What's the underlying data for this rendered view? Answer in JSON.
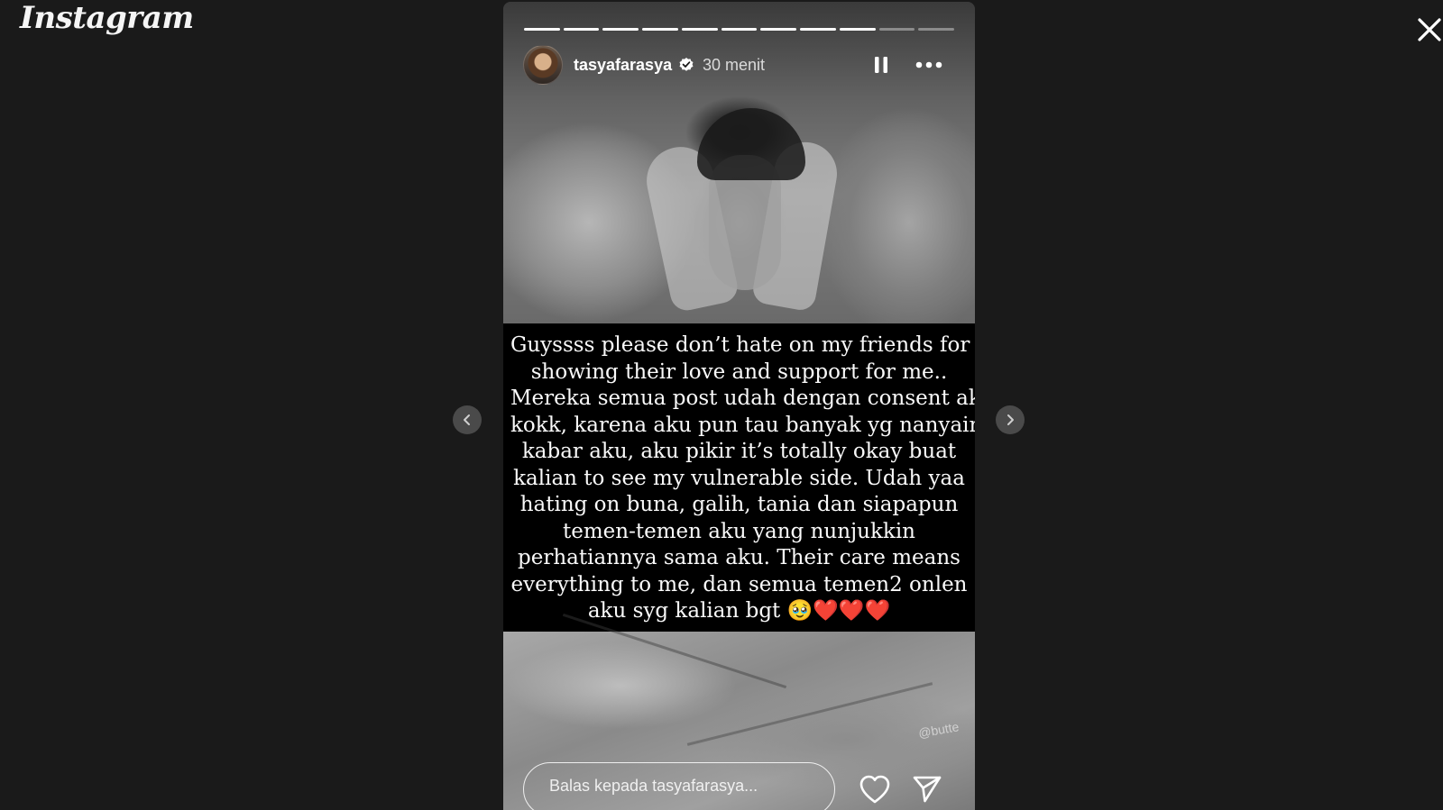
{
  "app": {
    "logo": "Instagram"
  },
  "story": {
    "username": "tasyafarasya",
    "verified": true,
    "time": "30 menit",
    "progress": {
      "segments": 11,
      "completed": 9
    },
    "caption_lines": [
      "Guyssss please don’t hate on my friends for",
      "showing their love and support for me..",
      "Mereka semua post udah dengan consent aku",
      "kokk, karena aku pun tau banyak yg nanyain",
      "kabar aku, aku pikir it’s totally okay buat",
      "kalian to see my vulnerable side. Udah yaa",
      "hating on buna, galih, tania dan siapapun",
      "temen-temen aku yang nunjukkin",
      "perhatiannya sama aku. Their care means",
      "everything to me, dan semua temen2 onlen",
      "aku syg kalian bgt 🥹❤️❤️❤️"
    ],
    "watermark": "@butte",
    "reply_placeholder": "Balas kepada tasyafarasya..."
  },
  "icons": {
    "close": "close-icon",
    "prev": "chevron-left-icon",
    "next": "chevron-right-icon",
    "pause": "pause-icon",
    "more": "more-horizontal-icon",
    "verified": "verified-badge-icon",
    "like": "heart-icon",
    "share": "send-icon"
  },
  "colors": {
    "background": "#1a1a1a",
    "verified_badge": "#ffffff"
  }
}
